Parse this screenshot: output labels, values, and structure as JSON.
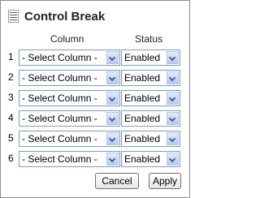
{
  "dialog": {
    "title": "Control Break"
  },
  "headers": {
    "column": "Column",
    "status": "Status"
  },
  "rows": [
    {
      "number": "1",
      "column": "- Select Column -",
      "status": "Enabled"
    },
    {
      "number": "2",
      "column": "- Select Column -",
      "status": "Enabled"
    },
    {
      "number": "3",
      "column": "- Select Column -",
      "status": "Enabled"
    },
    {
      "number": "4",
      "column": "- Select Column -",
      "status": "Enabled"
    },
    {
      "number": "5",
      "column": "- Select Column -",
      "status": "Enabled"
    },
    {
      "number": "6",
      "column": "- Select Column -",
      "status": "Enabled"
    }
  ],
  "buttons": {
    "cancel": "Cancel",
    "apply": "Apply"
  },
  "colors": {
    "select_border": "#7f9db9",
    "arrow_bg": "#c6d5f5",
    "panel_border": "#8f8f8f"
  },
  "icons": {
    "title": "grid-lines-icon",
    "dropdown": "chevron-down-icon"
  }
}
